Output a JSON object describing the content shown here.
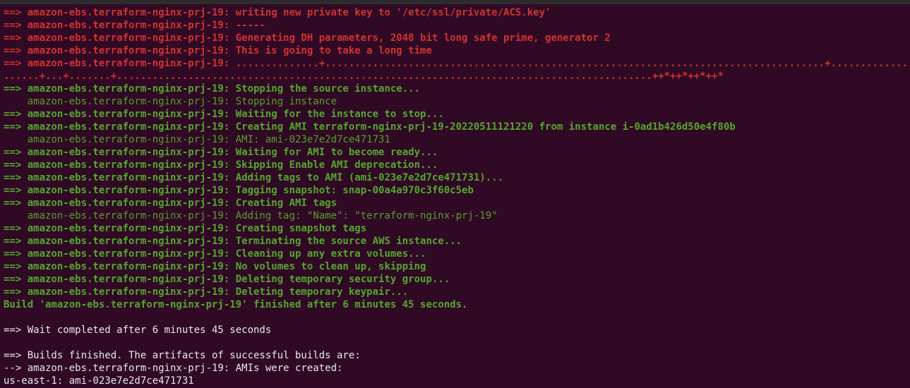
{
  "terminal": {
    "lines": [
      {
        "text": "==> amazon-ebs.terraform-nginx-prj-19: writing new private key to '/etc/ssl/private/ACS.key'",
        "style": "red"
      },
      {
        "text": "==> amazon-ebs.terraform-nginx-prj-19: -----",
        "style": "red"
      },
      {
        "text": "==> amazon-ebs.terraform-nginx-prj-19: Generating DH parameters, 2048 bit long safe prime, generator 2",
        "style": "red"
      },
      {
        "text": "==> amazon-ebs.terraform-nginx-prj-19: This is going to take a long time",
        "style": "red"
      },
      {
        "text": "==> amazon-ebs.terraform-nginx-prj-19: ..............+....................................................................................+...............",
        "style": "red"
      },
      {
        "text": "......+...+.......+..........................................................................................++*++*++*++*",
        "style": "red"
      },
      {
        "text": "==> amazon-ebs.terraform-nginx-prj-19: Stopping the source instance...",
        "style": "green-b"
      },
      {
        "text": "    amazon-ebs.terraform-nginx-prj-19: Stopping instance",
        "style": "green-n"
      },
      {
        "text": "==> amazon-ebs.terraform-nginx-prj-19: Waiting for the instance to stop...",
        "style": "green-b"
      },
      {
        "text": "==> amazon-ebs.terraform-nginx-prj-19: Creating AMI terraform-nginx-prj-19-20220511121220 from instance i-0ad1b426d50e4f80b",
        "style": "green-b"
      },
      {
        "text": "    amazon-ebs.terraform-nginx-prj-19: AMI: ami-023e7e2d7ce471731",
        "style": "green-n"
      },
      {
        "text": "==> amazon-ebs.terraform-nginx-prj-19: Waiting for AMI to become ready...",
        "style": "green-b"
      },
      {
        "text": "==> amazon-ebs.terraform-nginx-prj-19: Skipping Enable AMI deprecation...",
        "style": "green-b"
      },
      {
        "text": "==> amazon-ebs.terraform-nginx-prj-19: Adding tags to AMI (ami-023e7e2d7ce471731)...",
        "style": "green-b"
      },
      {
        "text": "==> amazon-ebs.terraform-nginx-prj-19: Tagging snapshot: snap-00a4a970c3f60c5eb",
        "style": "green-b"
      },
      {
        "text": "==> amazon-ebs.terraform-nginx-prj-19: Creating AMI tags",
        "style": "green-b"
      },
      {
        "text": "    amazon-ebs.terraform-nginx-prj-19: Adding tag: \"Name\": \"terraform-nginx-prj-19\"",
        "style": "green-n"
      },
      {
        "text": "==> amazon-ebs.terraform-nginx-prj-19: Creating snapshot tags",
        "style": "green-b"
      },
      {
        "text": "==> amazon-ebs.terraform-nginx-prj-19: Terminating the source AWS instance...",
        "style": "green-b"
      },
      {
        "text": "==> amazon-ebs.terraform-nginx-prj-19: Cleaning up any extra volumes...",
        "style": "green-b"
      },
      {
        "text": "==> amazon-ebs.terraform-nginx-prj-19: No volumes to clean up, skipping",
        "style": "green-b"
      },
      {
        "text": "==> amazon-ebs.terraform-nginx-prj-19: Deleting temporary security group...",
        "style": "green-b"
      },
      {
        "text": "==> amazon-ebs.terraform-nginx-prj-19: Deleting temporary keypair...",
        "style": "green-b"
      },
      {
        "text": "Build 'amazon-ebs.terraform-nginx-prj-19' finished after 6 minutes 45 seconds.",
        "style": "green-b"
      },
      {
        "text": "",
        "style": "white"
      },
      {
        "text": "==> Wait completed after 6 minutes 45 seconds",
        "style": "white"
      },
      {
        "text": "",
        "style": "white"
      },
      {
        "text": "==> Builds finished. The artifacts of successful builds are:",
        "style": "white"
      },
      {
        "text": "--> amazon-ebs.terraform-nginx-prj-19: AMIs were created:",
        "style": "white"
      },
      {
        "text": "us-east-1: ami-023e7e2d7ce471731",
        "style": "white"
      }
    ]
  },
  "colors": {
    "background": "#300a24",
    "error": "#d23232",
    "success": "#56a630",
    "plain": "#e8e8e8"
  }
}
